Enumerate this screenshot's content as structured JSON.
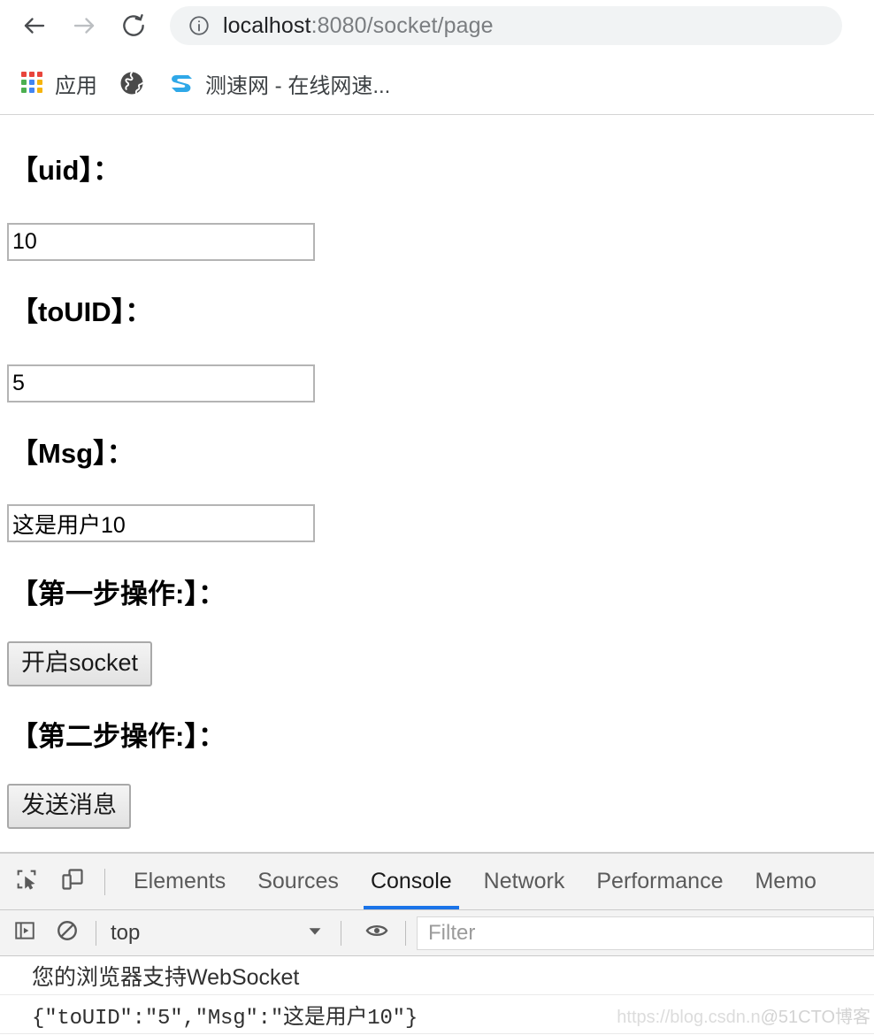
{
  "browser": {
    "nav": {
      "back_label": "Back",
      "forward_label": "Forward",
      "reload_label": "Reload"
    },
    "omnibox": {
      "info_icon": "info-circle-icon",
      "url_host": "localhost",
      "url_rest": ":8080/socket/page",
      "full_url": "localhost:8080/socket/page"
    },
    "bookmarks": [
      {
        "icon": "apps-grid-icon",
        "label": "应用"
      },
      {
        "icon": "globe-icon",
        "label": ""
      },
      {
        "icon": "speedtest-s-logo-icon",
        "label": "测速网 - 在线网速..."
      }
    ]
  },
  "page": {
    "fields": [
      {
        "label": "【uid】：",
        "value": "10",
        "placeholder": ""
      },
      {
        "label": "【toUID】：",
        "value": "5",
        "placeholder": ""
      },
      {
        "label": "【Msg】：",
        "value": "这是用户10",
        "placeholder": ""
      }
    ],
    "steps": [
      {
        "label": "【第一步操作:】：",
        "button": "开启socket"
      },
      {
        "label": "【第二步操作:】：",
        "button": "发送消息"
      }
    ]
  },
  "devtools": {
    "icons": {
      "inspect": "inspect-element-icon",
      "device": "device-toolbar-icon",
      "sidebar": "console-sidebar-icon",
      "clear": "clear-console-icon",
      "eye": "live-expression-eye-icon",
      "caret": "chevron-down-icon"
    },
    "tabs": [
      {
        "label": "Elements",
        "active": false
      },
      {
        "label": "Sources",
        "active": false
      },
      {
        "label": "Console",
        "active": true
      },
      {
        "label": "Network",
        "active": false
      },
      {
        "label": "Performance",
        "active": false
      },
      {
        "label": "Memo",
        "active": false
      }
    ],
    "active_tab_accent": "#1a73e8",
    "console_toolbar": {
      "context": "top",
      "filter_placeholder": "Filter"
    },
    "console_messages": [
      {
        "text": "您的浏览器支持WebSocket",
        "mono": false
      },
      {
        "text": "{\"toUID\":\"5\",\"Msg\":\"这是用户10\"}",
        "mono": true
      }
    ]
  },
  "watermark": {
    "left": "https://blog.csdn.n",
    "right": "@51CTO博客"
  }
}
